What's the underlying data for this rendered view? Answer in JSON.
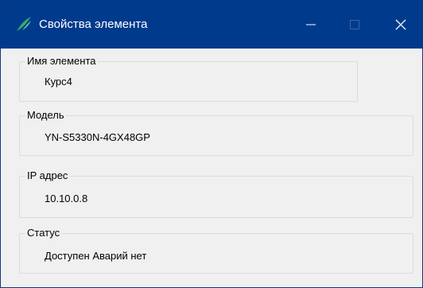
{
  "window": {
    "title": "Свойства элемента",
    "app_icon": "feather-logo-icon",
    "controls": {
      "minimize_icon": "minimize-icon",
      "maximize_icon": "maximize-icon",
      "close_icon": "close-icon"
    }
  },
  "fields": {
    "name": {
      "label": "Имя элемента",
      "value": "Курс4"
    },
    "model": {
      "label": "Модель",
      "value": "YN-S5330N-4GX48GP"
    },
    "ip": {
      "label": "IP адрес",
      "value": "10.10.0.8"
    },
    "status": {
      "label": "Статус",
      "value": "Доступен Аварий нет"
    }
  },
  "colors": {
    "titlebar": "#003a8c",
    "icon_accent": "#3aa76d",
    "background": "#f0f0f0"
  }
}
